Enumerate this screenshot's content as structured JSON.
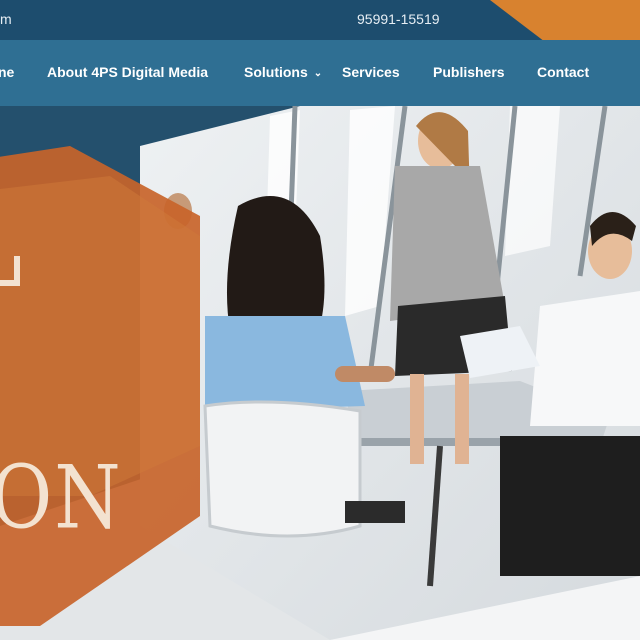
{
  "topbar": {
    "email_fragment": "m",
    "phone": "95991-15519",
    "phone_icon": "phone-icon"
  },
  "nav": {
    "items": [
      {
        "label": "ne"
      },
      {
        "label": "About 4PS Digital Media"
      },
      {
        "label": "Solutions",
        "has_dropdown": true
      },
      {
        "label": "Services"
      },
      {
        "label": "Publishers"
      },
      {
        "label": "Contact"
      }
    ]
  },
  "hero": {
    "word_fragment": "ON"
  },
  "colors": {
    "topbar": "#1d4d6e",
    "nav": "#2f6f93",
    "accent_orange": "#d8822f",
    "hex_orange": "#c8642a"
  }
}
